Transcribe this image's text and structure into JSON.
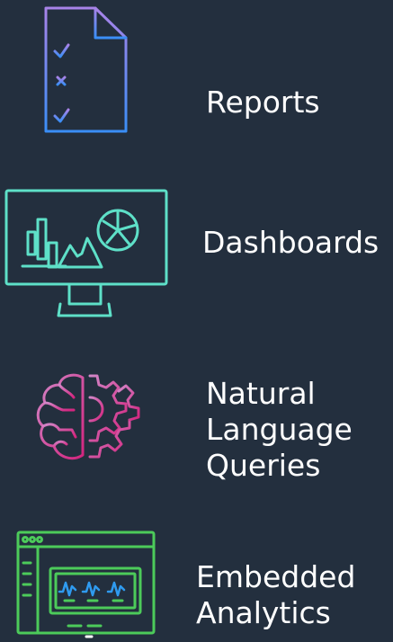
{
  "features": [
    {
      "id": "reports",
      "label_lines": [
        "Reports"
      ],
      "icon": "report-checklist-icon",
      "color_top": "#9b7fe3",
      "color_bottom": "#3d8df5"
    },
    {
      "id": "dashboards",
      "label_lines": [
        "Dashboards"
      ],
      "icon": "dashboard-monitor-icon",
      "color": "#5ee0c8"
    },
    {
      "id": "nlq",
      "label_lines": [
        "Natural",
        "Language",
        "Queries"
      ],
      "icon": "brain-gear-icon",
      "color_top": "#c04fa8",
      "color_bottom": "#e0307a"
    },
    {
      "id": "embedded",
      "label_lines": [
        "Embedded",
        "Analytics"
      ],
      "icon": "embedded-window-icon",
      "color": "#4ccb5a"
    }
  ]
}
